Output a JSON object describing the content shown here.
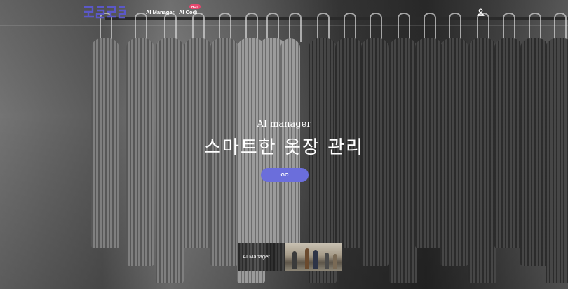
{
  "header": {
    "logo_text": "코디",
    "nav": [
      {
        "label": "AI Manager"
      },
      {
        "label": "AI Codi",
        "badge": "HOT"
      }
    ],
    "user_icon": "user-icon"
  },
  "hero": {
    "subtitle": "AI manager",
    "title": "스마트한 옷장 관리",
    "go_label": "GO"
  },
  "thumbnails": [
    {
      "label": "AI Manager"
    },
    {
      "label": ""
    }
  ],
  "colors": {
    "accent": "#6b6edb",
    "logo": "#5b58c8",
    "badge": "#e6466d"
  }
}
